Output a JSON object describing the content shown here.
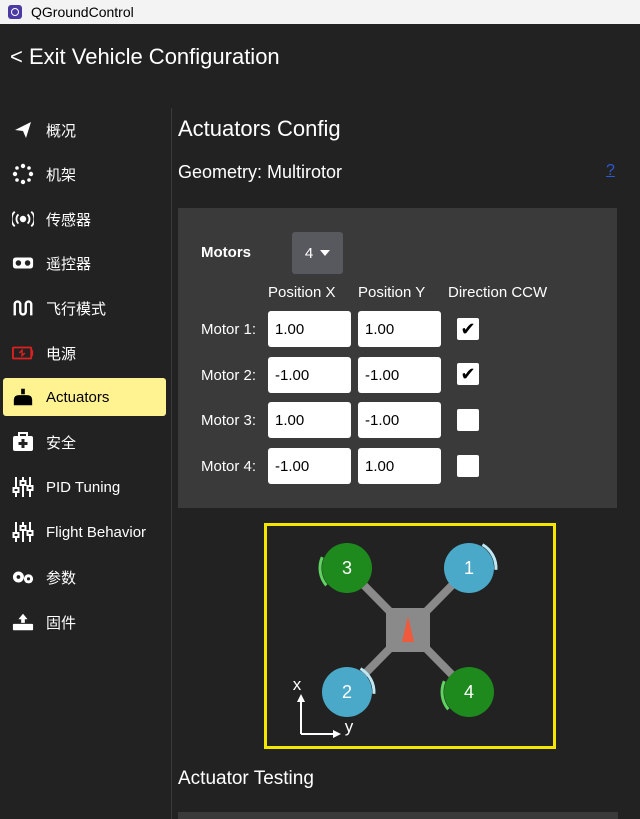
{
  "window": {
    "title": "QGroundControl",
    "icon": "qgc-app-icon"
  },
  "header": {
    "back_label": "< Exit Vehicle Configuration"
  },
  "sidebar": {
    "items": [
      {
        "label": "概况",
        "icon": "paper-plane-icon",
        "active": false
      },
      {
        "label": "机架",
        "icon": "airframe-icon",
        "active": false
      },
      {
        "label": "传感器",
        "icon": "sensors-icon",
        "active": false
      },
      {
        "label": "遥控器",
        "icon": "radio-controller-icon",
        "active": false
      },
      {
        "label": "飞行模式",
        "icon": "flight-modes-icon",
        "active": false
      },
      {
        "label": "电源",
        "icon": "battery-icon",
        "active": false
      },
      {
        "label": "Actuators",
        "icon": "actuators-icon",
        "active": true
      },
      {
        "label": "安全",
        "icon": "safety-icon",
        "active": false
      },
      {
        "label": "PID Tuning",
        "icon": "sliders-icon",
        "active": false
      },
      {
        "label": "Flight Behavior",
        "icon": "sliders-icon",
        "active": false
      },
      {
        "label": "参数",
        "icon": "gears-icon",
        "active": false
      },
      {
        "label": "固件",
        "icon": "firmware-icon",
        "active": false
      }
    ],
    "active_color": "#fff291"
  },
  "main": {
    "title": "Actuators Config",
    "geometry_label": "Geometry: Multirotor",
    "help_link": "?",
    "motors": {
      "label": "Motors",
      "count": "4",
      "columns": [
        "Position X",
        "Position Y",
        "Direction CCW"
      ],
      "rows": [
        {
          "label": "Motor 1:",
          "x": "1.00",
          "y": "1.00",
          "ccw": true
        },
        {
          "label": "Motor 2:",
          "x": "-1.00",
          "y": "-1.00",
          "ccw": true
        },
        {
          "label": "Motor 3:",
          "x": "1.00",
          "y": "-1.00",
          "ccw": false
        },
        {
          "label": "Motor 4:",
          "x": "-1.00",
          "y": "1.00",
          "ccw": false
        }
      ]
    },
    "diagram": {
      "motors": [
        {
          "number": "1",
          "color": "#4aa9c9",
          "position": "front-right"
        },
        {
          "number": "2",
          "color": "#4aa9c9",
          "position": "rear-left"
        },
        {
          "number": "3",
          "color": "#1e8a1e",
          "position": "front-left"
        },
        {
          "number": "4",
          "color": "#1e8a1e",
          "position": "rear-right"
        }
      ],
      "axis_x": "x",
      "axis_y": "y",
      "border_color": "#f5e600",
      "heading_color": "#f05a3c"
    },
    "testing_title": "Actuator Testing"
  }
}
